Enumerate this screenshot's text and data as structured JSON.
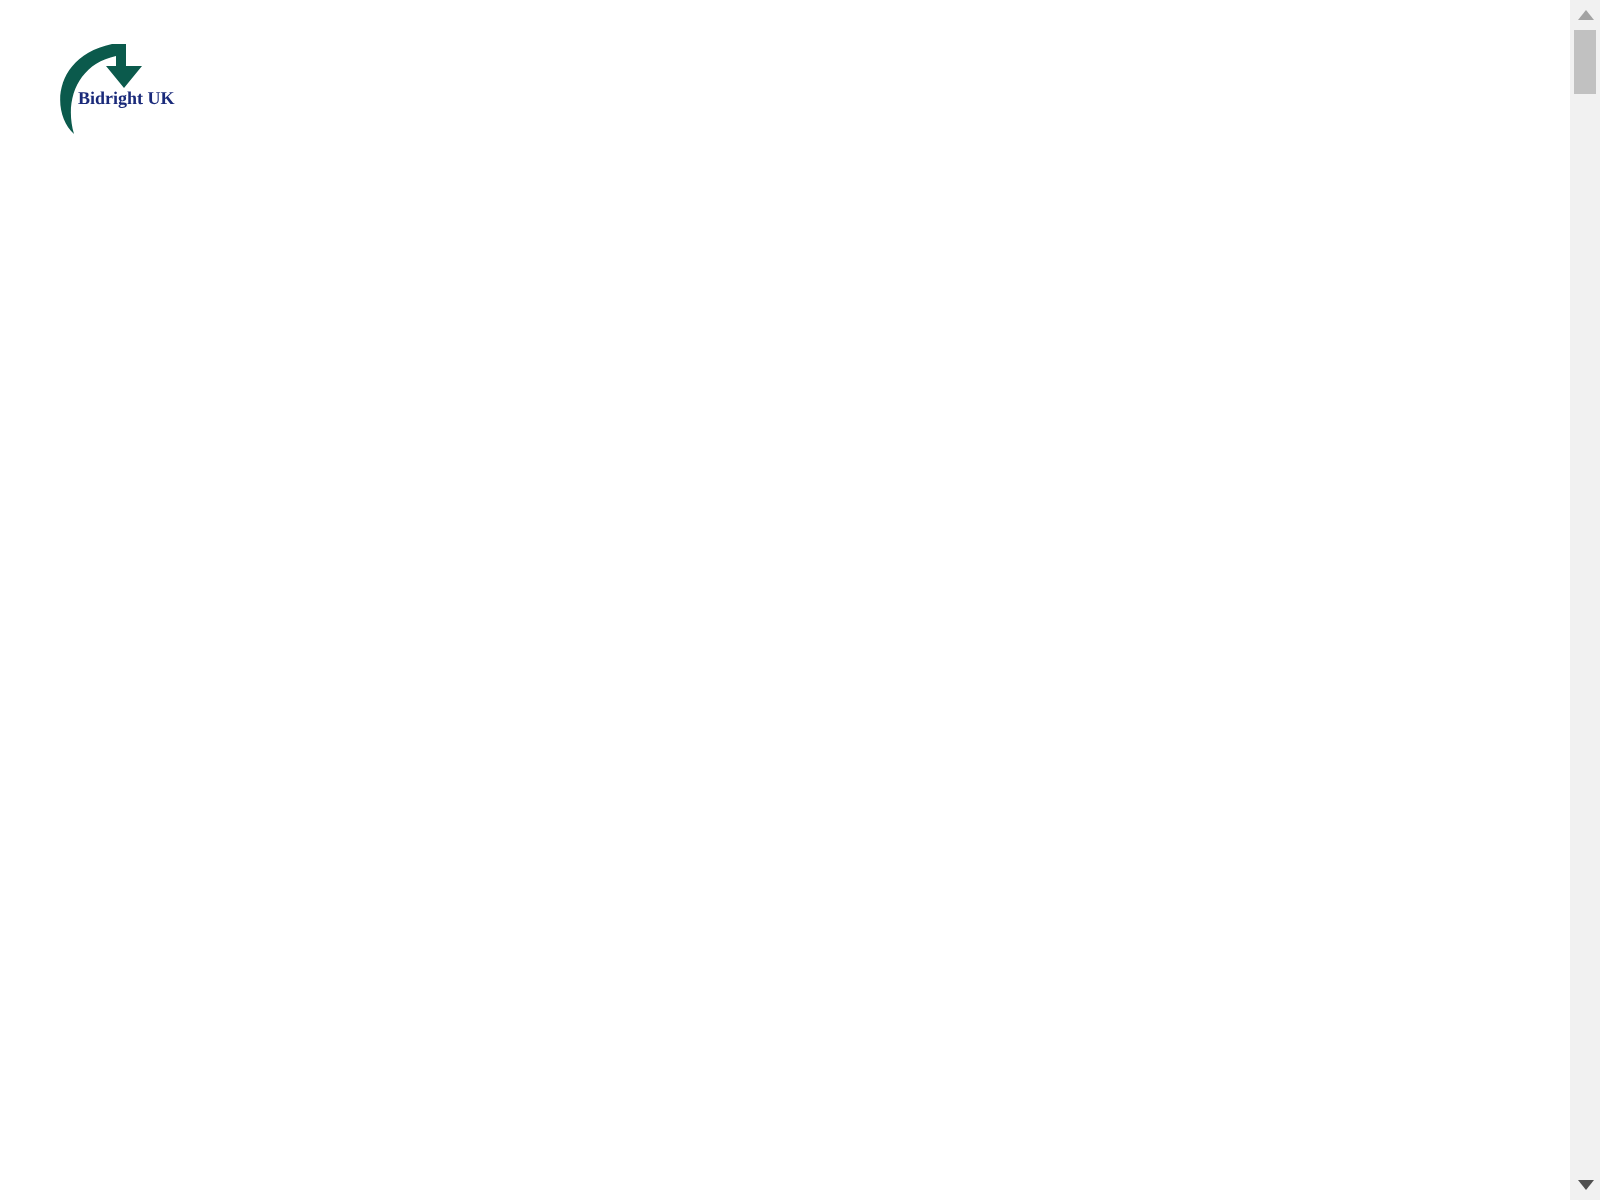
{
  "header": {
    "brand": "Bidright UK"
  }
}
